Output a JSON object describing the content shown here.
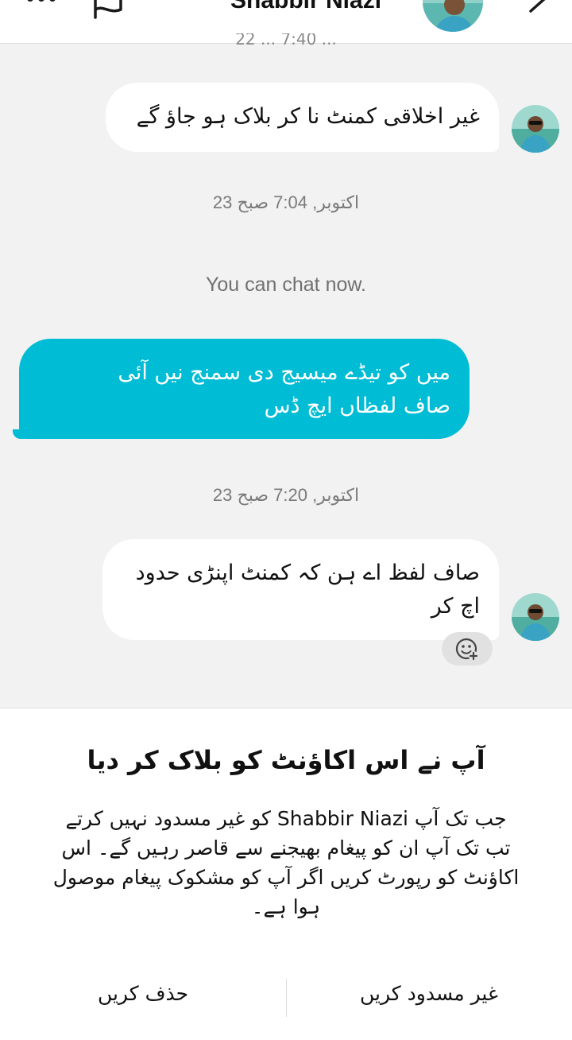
{
  "header": {
    "contact_name": "Shabbir Niazi",
    "icons": [
      "more-icon",
      "flag-icon",
      "avatar",
      "chevron-icon"
    ]
  },
  "messages": {
    "partial_time_above": "22 ... 7:40 ...",
    "msg1_lines": [
      "غیر اخلاقی کمنٹ نا کر بلاک ہو جاؤ گے"
    ],
    "time1": "23 اکتوبر, 7:04 صبح",
    "system_note": "You can chat now.",
    "msg2_lines": [
      "میں کو تیڈے میسیج دی سمنج نیں آئی",
      "صاف لفظاں ایچ ڈس"
    ],
    "time2": "23 اکتوبر, 7:20 صبح",
    "msg3_lines": [
      "صاف لفظ اے ہن کہ کمنٹ اپنڑی حدود",
      "اچ کر"
    ]
  },
  "block_sheet": {
    "title": "آپ نے اس اکاؤنٹ کو بلاک کر دیا",
    "body_lines": [
      "جب تک آپ Shabbir Niazi کو غیر مسدود نہیں کرتے",
      "تب تک آپ ان کو پیغام بھیجنے سے قاصر رہیں گے۔ اس",
      "اکاؤنٹ کو رپورٹ کریں اگر آپ کو مشکوک پیغام موصول",
      "ہوا ہے۔"
    ],
    "unblock_label": "غیر مسدود کریں",
    "delete_label": "حذف کریں"
  },
  "colors": {
    "outgoing_bubble": "#00bcd4",
    "incoming_bubble": "#ffffff",
    "background": "#f2f2f2"
  }
}
